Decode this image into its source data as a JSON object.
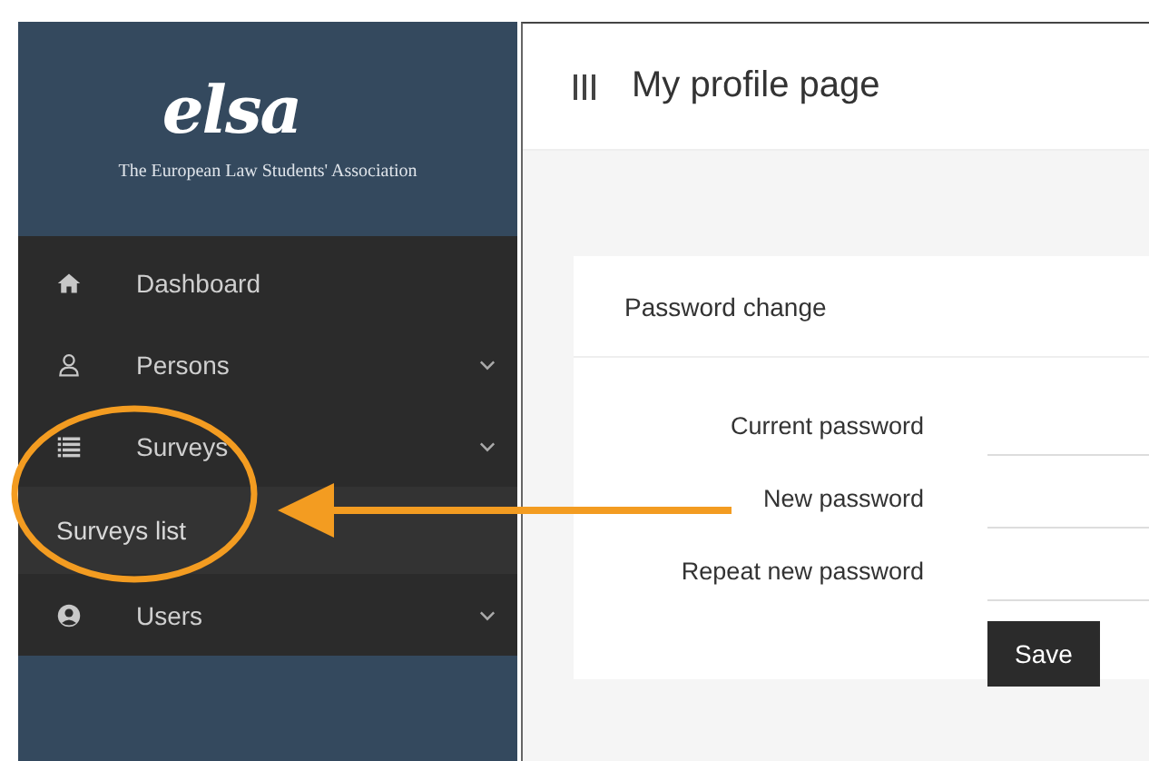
{
  "logo": {
    "mark": "elsa",
    "subtitle": "The European Law Students' Association"
  },
  "sidebar": {
    "items": [
      {
        "label": "Dashboard",
        "expandable": false
      },
      {
        "label": "Persons",
        "expandable": true
      },
      {
        "label": "Surveys",
        "expandable": true,
        "children": [
          {
            "label": "Surveys list"
          }
        ]
      },
      {
        "label": "Users",
        "expandable": true
      }
    ]
  },
  "header": {
    "title": "My profile page"
  },
  "card": {
    "title": "Password change",
    "fields": [
      {
        "label": "Current password"
      },
      {
        "label": "New password"
      },
      {
        "label": "Repeat new password"
      }
    ],
    "button": "Save"
  }
}
